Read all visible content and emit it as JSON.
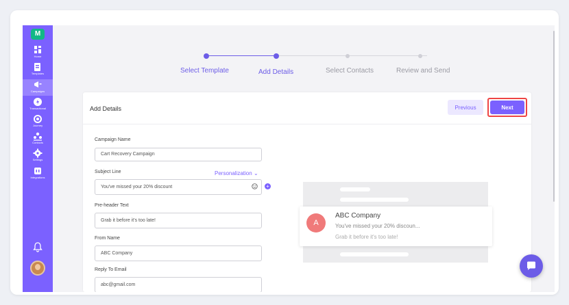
{
  "sidebar": {
    "logo": "M",
    "items": [
      {
        "label": "Home",
        "icon": "grid-icon"
      },
      {
        "label": "Templates",
        "icon": "templates-icon"
      },
      {
        "label": "Campaigns",
        "icon": "megaphone-icon",
        "active": true
      },
      {
        "label": "Transactional",
        "icon": "transactional-icon"
      },
      {
        "label": "Journey",
        "icon": "journey-icon"
      },
      {
        "label": "Contacts",
        "icon": "contacts-icon"
      },
      {
        "label": "Settings",
        "icon": "gear-icon"
      },
      {
        "label": "Integrations",
        "icon": "integrations-icon"
      }
    ]
  },
  "stepper": {
    "steps": [
      {
        "label": "Select Template",
        "state": "done"
      },
      {
        "label": "Add Details",
        "state": "done"
      },
      {
        "label": "Select Contacts",
        "state": "todo"
      },
      {
        "label": "Review and Send",
        "state": "todo"
      }
    ]
  },
  "card": {
    "title": "Add Details",
    "previous_label": "Previous",
    "next_label": "Next"
  },
  "form": {
    "campaign_name": {
      "label": "Campaign Name",
      "value": "Cart Recovery Campaign"
    },
    "subject_line": {
      "label": "Subject Line",
      "value": "You've missed your 20% discount",
      "personalization": "Personalization"
    },
    "preheader": {
      "label": "Pre-header Text",
      "value": "Grab it before it's too late!"
    },
    "from_name": {
      "label": "From Name",
      "value": "ABC Company"
    },
    "reply_to": {
      "label": "Reply To Email",
      "value": "abc@gmail.com"
    }
  },
  "preview": {
    "avatar_letter": "A",
    "sender": "ABC Company",
    "subject": "You've missed your 20% discoun...",
    "preheader": "Grab it before it's too late!"
  },
  "colors": {
    "accent": "#7b61ff",
    "highlight": "#ee4444",
    "avatar": "#f07a7a"
  }
}
